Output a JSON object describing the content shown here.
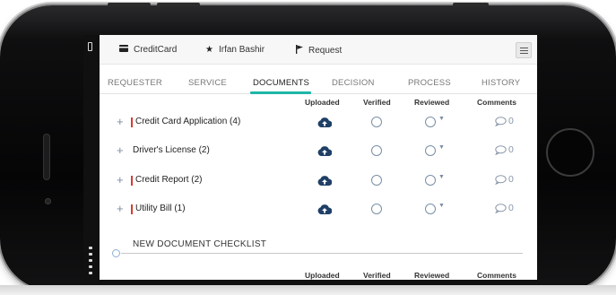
{
  "topbar": {
    "app_label": "CreditCard",
    "user_label": "Irfan Bashir",
    "request_label": "Request"
  },
  "tabs": [
    {
      "label": "REQUESTER",
      "active": false
    },
    {
      "label": "SERVICE",
      "active": false
    },
    {
      "label": "DOCUMENTS",
      "active": true
    },
    {
      "label": "DECISION",
      "active": false
    },
    {
      "label": "PROCESS",
      "active": false
    },
    {
      "label": "HISTORY",
      "active": false
    }
  ],
  "columns": {
    "uploaded": "Uploaded",
    "verified": "Verified",
    "reviewed": "Reviewed",
    "comments": "Comments"
  },
  "documents": [
    {
      "name": "Credit Card Application (4)",
      "required": true,
      "comments": "0"
    },
    {
      "name": "Driver's License (2)",
      "required": false,
      "comments": "0"
    },
    {
      "name": "Credit Report (2)",
      "required": true,
      "comments": "0"
    },
    {
      "name": "Utility Bill (1)",
      "required": true,
      "comments": "0"
    }
  ],
  "checklist": {
    "title": "NEW DOCUMENT CHECKLIST"
  },
  "colors": {
    "accent": "#1fb6a8",
    "required_flag": "#d83a32",
    "upload_icon": "#1f3f66",
    "status_icon": "#7a8fa6"
  },
  "icons": {
    "app": "credit-card-icon",
    "user": "star-icon",
    "request": "flag-icon",
    "menu": "hamburger-icon",
    "add": "plus-icon",
    "upload": "cloud-upload-icon",
    "verify": "circle-icon",
    "review": "circle-dropdown-icon",
    "comment": "speech-bubble-icon"
  }
}
